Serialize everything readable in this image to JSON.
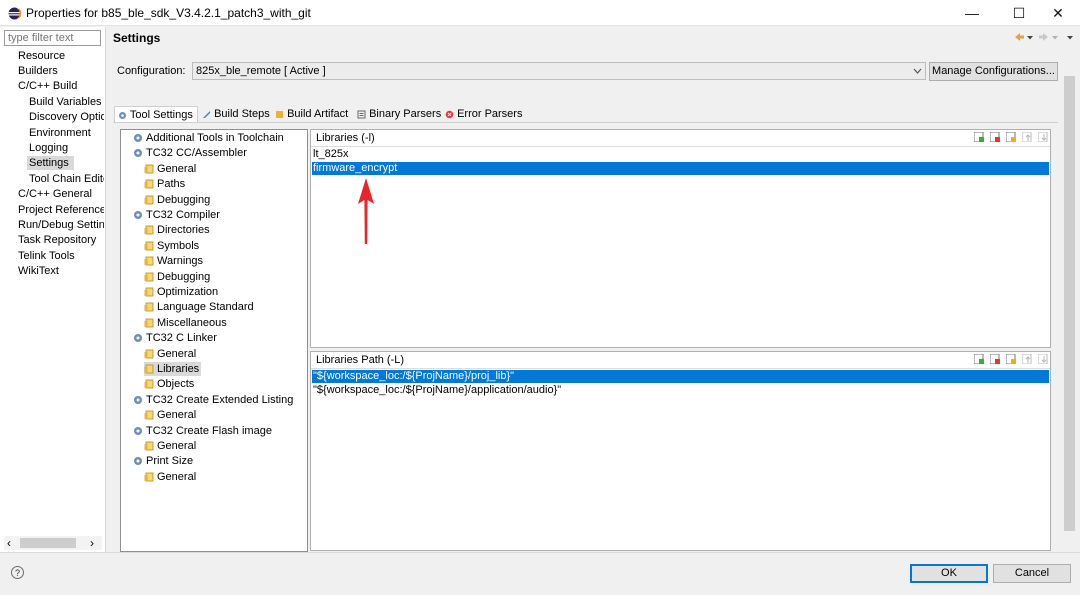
{
  "window": {
    "title": "Properties for b85_ble_sdk_V3.4.2.1_patch3_with_git",
    "minimize_glyph": "—",
    "maximize_glyph": "☐",
    "close_glyph": "✕"
  },
  "nav": {
    "filter_placeholder": "type filter text",
    "items": [
      {
        "label": "Resource"
      },
      {
        "label": "Builders"
      },
      {
        "label": "C/C++ Build"
      },
      {
        "label": "Build Variables"
      },
      {
        "label": "Discovery Options"
      },
      {
        "label": "Environment"
      },
      {
        "label": "Logging"
      },
      {
        "label": "Settings"
      },
      {
        "label": "Tool Chain Editor"
      },
      {
        "label": "C/C++ General"
      },
      {
        "label": "Project References"
      },
      {
        "label": "Run/Debug Settings"
      },
      {
        "label": "Task Repository"
      },
      {
        "label": "Telink Tools"
      },
      {
        "label": "WikiText"
      }
    ],
    "selected": "Settings",
    "scroll_left_glyph": "‹",
    "scroll_right_glyph": "›"
  },
  "main": {
    "title": "Settings",
    "configuration_label": "Configuration:",
    "configuration_value": "825x_ble_remote  [ Active ]",
    "manage_button": "Manage Configurations..."
  },
  "tabs": [
    {
      "label": "Tool Settings",
      "icon": "tool-settings-icon",
      "active": true
    },
    {
      "label": "Build Steps",
      "icon": "build-steps-icon",
      "active": false
    },
    {
      "label": "Build Artifact",
      "icon": "build-artifact-icon",
      "active": false
    },
    {
      "label": "Binary Parsers",
      "icon": "binary-parsers-icon",
      "active": false
    },
    {
      "label": "Error Parsers",
      "icon": "error-parsers-icon",
      "active": false
    }
  ],
  "tree": [
    {
      "label": "Additional Tools in Toolchain",
      "level": 0
    },
    {
      "label": "TC32 CC/Assembler",
      "level": 0
    },
    {
      "label": "General",
      "level": 1
    },
    {
      "label": "Paths",
      "level": 1
    },
    {
      "label": "Debugging",
      "level": 1
    },
    {
      "label": "TC32 Compiler",
      "level": 0
    },
    {
      "label": "Directories",
      "level": 1
    },
    {
      "label": "Symbols",
      "level": 1
    },
    {
      "label": "Warnings",
      "level": 1
    },
    {
      "label": "Debugging",
      "level": 1
    },
    {
      "label": "Optimization",
      "level": 1
    },
    {
      "label": "Language Standard",
      "level": 1
    },
    {
      "label": "Miscellaneous",
      "level": 1
    },
    {
      "label": "TC32 C Linker",
      "level": 0
    },
    {
      "label": "General",
      "level": 1
    },
    {
      "label": "Libraries",
      "level": 1,
      "selected": true
    },
    {
      "label": "Objects",
      "level": 1
    },
    {
      "label": "TC32 Create Extended Listing",
      "level": 0
    },
    {
      "label": "General",
      "level": 1
    },
    {
      "label": "TC32 Create Flash image",
      "level": 0
    },
    {
      "label": "General",
      "level": 1
    },
    {
      "label": "Print Size",
      "level": 0
    },
    {
      "label": "General",
      "level": 1
    }
  ],
  "libraries": {
    "header": "Libraries (-l)",
    "items": [
      {
        "value": "lt_825x",
        "selected": false
      },
      {
        "value": "firmware_encrypt",
        "selected": true
      }
    ]
  },
  "library_paths": {
    "header": "Libraries Path (-L)",
    "items": [
      {
        "value": "\"${workspace_loc:/${ProjName}/proj_lib}\"",
        "selected": true
      },
      {
        "value": "\"${workspace_loc:/${ProjName}/application/audio}\"",
        "selected": false
      }
    ]
  },
  "footer": {
    "help_glyph": "?",
    "ok_label": "OK",
    "cancel_label": "Cancel"
  },
  "colors": {
    "selection": "#0078d7",
    "annotation_arrow": "#e8252d"
  }
}
